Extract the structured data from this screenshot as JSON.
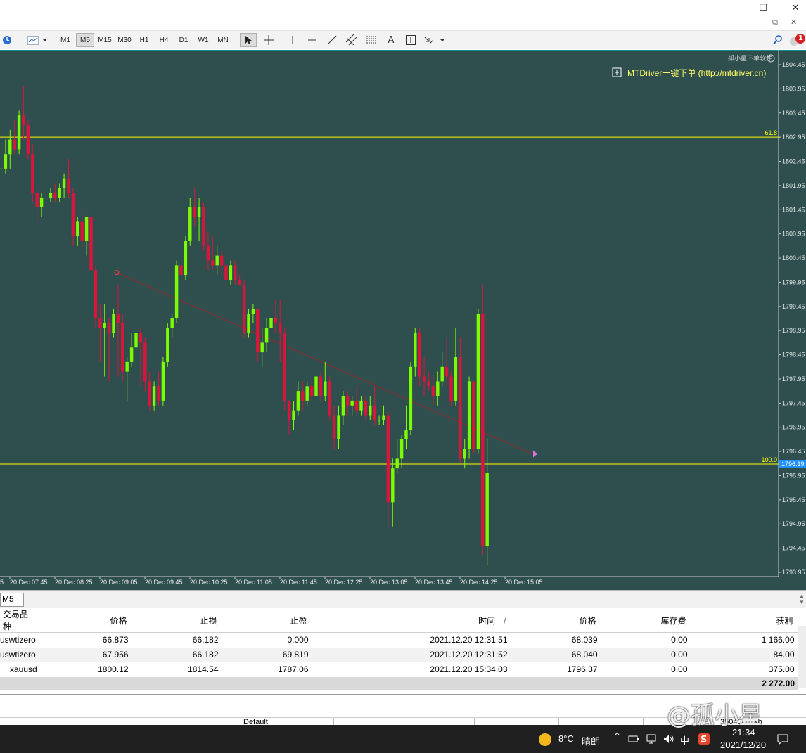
{
  "window": {
    "minimize": "—",
    "maximize": "☐",
    "close": "✕",
    "mdi_restore": "⧉",
    "mdi_close": "✕"
  },
  "toolbar": {
    "timeframes": [
      "M1",
      "M5",
      "M15",
      "M30",
      "H1",
      "H4",
      "D1",
      "W1",
      "MN"
    ],
    "active_timeframe": "M5",
    "text_tool": "A",
    "label_tool": "T",
    "notif_count": "1"
  },
  "chart": {
    "broker_text": "孤小星下单软件",
    "panel_text": "MTDriver一键下单 (http://mtdriver.cn)",
    "fib_labels": [
      {
        "label": "61.8",
        "price": 1802.95
      },
      {
        "label": "100.0",
        "price": 1796.19
      }
    ],
    "current_price_tag": "1796.19",
    "price_axis": [
      "1804.45",
      "1803.95",
      "1803.45",
      "1802.95",
      "1802.45",
      "1801.95",
      "1801.45",
      "1800.95",
      "1800.45",
      "1799.95",
      "1799.45",
      "1798.95",
      "1798.45",
      "1797.95",
      "1797.45",
      "1796.95",
      "1796.45",
      "1795.95",
      "1795.45",
      "1794.95",
      "1794.45",
      "1793.95"
    ],
    "time_axis": [
      "20 Dec 07:45",
      "20 Dec 08:25",
      "20 Dec 09:05",
      "20 Dec 09:45",
      "20 Dec 10:25",
      "20 Dec 11:05",
      "20 Dec 11:45",
      "20 Dec 12:25",
      "20 Dec 13:05",
      "20 Dec 13:45",
      "20 Dec 14:25",
      "20 Dec 15:05"
    ],
    "time_axis_partial": "5",
    "bull_color": "#7cfc00",
    "bear_color": "#dc143c",
    "background": "#2f4f4f",
    "fib_color": "#ffff00",
    "trend_color": "#a0222a",
    "candles": [
      [
        1802.3,
        1802.5,
        1802.1,
        1802.3
      ],
      [
        1802.3,
        1802.9,
        1802.2,
        1802.6
      ],
      [
        1802.6,
        1803.1,
        1802.3,
        1802.9
      ],
      [
        1802.9,
        1803.3,
        1802.6,
        1802.7
      ],
      [
        1802.7,
        1803.5,
        1802.6,
        1803.4
      ],
      [
        1803.4,
        1804.0,
        1802.9,
        1803.2
      ],
      [
        1803.2,
        1803.3,
        1802.5,
        1802.6
      ],
      [
        1802.6,
        1802.8,
        1801.6,
        1801.8
      ],
      [
        1801.8,
        1801.9,
        1801.2,
        1801.5
      ],
      [
        1801.5,
        1801.8,
        1801.3,
        1801.7
      ],
      [
        1801.7,
        1802.1,
        1801.6,
        1801.7
      ],
      [
        1801.7,
        1801.9,
        1801.6,
        1801.8
      ],
      [
        1801.8,
        1802.0,
        1801.6,
        1801.7
      ],
      [
        1801.7,
        1802.0,
        1801.6,
        1801.9
      ],
      [
        1801.9,
        1802.2,
        1801.7,
        1802.1
      ],
      [
        1802.1,
        1802.5,
        1801.7,
        1801.8
      ],
      [
        1801.8,
        1801.9,
        1800.7,
        1800.9
      ],
      [
        1800.9,
        1801.3,
        1800.7,
        1801.2
      ],
      [
        1801.2,
        1801.5,
        1800.6,
        1800.8
      ],
      [
        1800.8,
        1801.3,
        1800.5,
        1801.3
      ],
      [
        1801.3,
        1801.4,
        1800.1,
        1800.2
      ],
      [
        1800.2,
        1800.3,
        1799.0,
        1799.2
      ],
      [
        1799.2,
        1799.5,
        1798.3,
        1799.0
      ],
      [
        1799.0,
        1799.5,
        1798.0,
        1799.1
      ],
      [
        1799.1,
        1799.2,
        1797.9,
        1798.9
      ],
      [
        1798.9,
        1799.4,
        1798.8,
        1799.3
      ],
      [
        1799.3,
        1799.9,
        1798.0,
        1799.1
      ],
      [
        1799.1,
        1799.3,
        1797.9,
        1798.1
      ],
      [
        1798.1,
        1798.4,
        1797.5,
        1798.3
      ],
      [
        1798.3,
        1798.9,
        1798.2,
        1798.6
      ],
      [
        1798.6,
        1799.0,
        1797.8,
        1798.9
      ],
      [
        1798.9,
        1799.0,
        1797.8,
        1798.7
      ],
      [
        1798.7,
        1798.8,
        1797.7,
        1797.9
      ],
      [
        1797.9,
        1798.1,
        1797.3,
        1797.4
      ],
      [
        1797.4,
        1797.9,
        1797.3,
        1797.8
      ],
      [
        1797.8,
        1798.1,
        1797.4,
        1797.5
      ],
      [
        1797.5,
        1798.4,
        1797.4,
        1798.3
      ],
      [
        1798.3,
        1799.1,
        1798.2,
        1799.0
      ],
      [
        1799.0,
        1799.3,
        1798.8,
        1799.2
      ],
      [
        1799.2,
        1800.4,
        1799.1,
        1800.3
      ],
      [
        1800.3,
        1800.5,
        1799.8,
        1800.1
      ],
      [
        1800.1,
        1800.9,
        1800.0,
        1800.8
      ],
      [
        1800.8,
        1801.7,
        1800.7,
        1801.5
      ],
      [
        1801.5,
        1801.9,
        1801.1,
        1801.3
      ],
      [
        1801.3,
        1801.7,
        1800.8,
        1801.5
      ],
      [
        1801.5,
        1801.6,
        1800.6,
        1800.7
      ],
      [
        1800.7,
        1801.0,
        1800.2,
        1800.4
      ],
      [
        1800.4,
        1800.9,
        1800.2,
        1800.3
      ],
      [
        1800.3,
        1800.7,
        1800.1,
        1800.5
      ],
      [
        1800.5,
        1800.6,
        1800.1,
        1800.3
      ],
      [
        1800.3,
        1800.4,
        1799.9,
        1800.0
      ],
      [
        1800.0,
        1800.4,
        1799.9,
        1800.3
      ],
      [
        1800.3,
        1800.4,
        1799.9,
        1800.0
      ],
      [
        1800.0,
        1800.1,
        1799.9,
        1799.9
      ],
      [
        1799.9,
        1800.0,
        1798.8,
        1798.9
      ],
      [
        1798.9,
        1799.4,
        1798.8,
        1799.3
      ],
      [
        1799.3,
        1799.5,
        1799.1,
        1799.4
      ],
      [
        1799.4,
        1799.4,
        1798.3,
        1798.5
      ],
      [
        1798.5,
        1799.0,
        1798.2,
        1798.7
      ],
      [
        1798.7,
        1799.2,
        1798.5,
        1799.0
      ],
      [
        1799.0,
        1799.3,
        1798.6,
        1799.2
      ],
      [
        1799.2,
        1799.6,
        1798.9,
        1799.1
      ],
      [
        1799.1,
        1799.6,
        1798.3,
        1798.9
      ],
      [
        1798.9,
        1799.0,
        1797.3,
        1797.5
      ],
      [
        1797.5,
        1797.5,
        1796.8,
        1797.1
      ],
      [
        1797.1,
        1797.5,
        1796.9,
        1797.3
      ],
      [
        1797.3,
        1797.9,
        1797.2,
        1797.7
      ],
      [
        1797.7,
        1797.9,
        1797.3,
        1797.5
      ],
      [
        1797.5,
        1797.9,
        1797.4,
        1797.8
      ],
      [
        1797.8,
        1797.9,
        1797.5,
        1797.6
      ],
      [
        1797.6,
        1798.0,
        1797.5,
        1798.0
      ],
      [
        1798.0,
        1798.1,
        1797.5,
        1797.6
      ],
      [
        1797.6,
        1798.3,
        1797.5,
        1797.9
      ],
      [
        1797.9,
        1798.0,
        1797.1,
        1797.2
      ],
      [
        1797.2,
        1797.4,
        1796.5,
        1796.7
      ],
      [
        1796.7,
        1797.4,
        1796.5,
        1797.2
      ],
      [
        1797.2,
        1797.7,
        1797.0,
        1797.6
      ],
      [
        1797.6,
        1797.7,
        1797.2,
        1797.4
      ],
      [
        1797.4,
        1797.6,
        1797.2,
        1797.5
      ],
      [
        1797.5,
        1797.8,
        1797.2,
        1797.3
      ],
      [
        1797.3,
        1797.6,
        1797.2,
        1797.5
      ],
      [
        1797.5,
        1797.6,
        1797.1,
        1797.2
      ],
      [
        1797.2,
        1797.6,
        1797.1,
        1797.4
      ],
      [
        1797.4,
        1797.8,
        1797.0,
        1797.1
      ],
      [
        1797.1,
        1797.2,
        1797.0,
        1797.1
      ],
      [
        1797.1,
        1797.4,
        1797.0,
        1797.2
      ],
      [
        1797.2,
        1797.3,
        1794.9,
        1795.4
      ],
      [
        1795.4,
        1796.3,
        1794.9,
        1796.1
      ],
      [
        1796.1,
        1796.7,
        1796.0,
        1796.3
      ],
      [
        1796.3,
        1796.8,
        1796.1,
        1796.7
      ],
      [
        1796.7,
        1797.4,
        1796.5,
        1796.9
      ],
      [
        1796.9,
        1798.3,
        1796.8,
        1798.2
      ],
      [
        1798.2,
        1799.0,
        1798.0,
        1798.9
      ],
      [
        1798.9,
        1799.0,
        1797.8,
        1798.0
      ],
      [
        1798.0,
        1798.4,
        1797.6,
        1797.9
      ],
      [
        1797.9,
        1798.1,
        1797.7,
        1797.8
      ],
      [
        1797.8,
        1798.0,
        1797.4,
        1797.6
      ],
      [
        1797.6,
        1798.1,
        1797.4,
        1797.9
      ],
      [
        1797.9,
        1798.5,
        1797.8,
        1798.2
      ],
      [
        1798.2,
        1798.8,
        1797.8,
        1798.0
      ],
      [
        1798.0,
        1798.1,
        1797.4,
        1797.5
      ],
      [
        1797.5,
        1799.0,
        1797.4,
        1798.4
      ],
      [
        1798.4,
        1798.8,
        1796.2,
        1796.3
      ],
      [
        1796.3,
        1796.7,
        1796.1,
        1796.5
      ],
      [
        1796.5,
        1798.0,
        1796.3,
        1797.9
      ],
      [
        1797.9,
        1797.9,
        1796.4,
        1796.5
      ],
      [
        1796.5,
        1799.4,
        1796.4,
        1799.3
      ],
      [
        1799.3,
        1799.9,
        1794.3,
        1794.5
      ],
      [
        1794.5,
        1796.7,
        1794.1,
        1796.0
      ]
    ],
    "fib_line_1": "61.8",
    "fib_line_2": "100.0"
  },
  "tabs": {
    "active": "M5"
  },
  "terminal": {
    "headers": [
      "交易品种",
      "价格",
      "止损",
      "止盈",
      "时间",
      "价格",
      "库存费",
      "获利"
    ],
    "sort_indicator": "/",
    "rows": [
      [
        "uswtizero",
        "66.873",
        "66.182",
        "0.000",
        "2021.12.20 12:31:51",
        "68.039",
        "0.00",
        "1 166.00"
      ],
      [
        "uswtizero",
        "67.956",
        "66.182",
        "69.819",
        "2021.12.20 12:31:52",
        "68.040",
        "0.00",
        "84.00"
      ],
      [
        "xauusd",
        "1800.12",
        "1814.54",
        "1787.06",
        "2021.12.20 15:34:03",
        "1796.37",
        "0.00",
        "375.00"
      ]
    ],
    "total": "2 272.00"
  },
  "statusbar": {
    "profile": "Default",
    "traffic": "35045/11 kb"
  },
  "taskbar": {
    "weather_temp": "8°C",
    "weather_desc": "晴朗",
    "ime": "中",
    "time": "21:34",
    "date": "2021/12/20"
  },
  "watermark": "@孤小星"
}
